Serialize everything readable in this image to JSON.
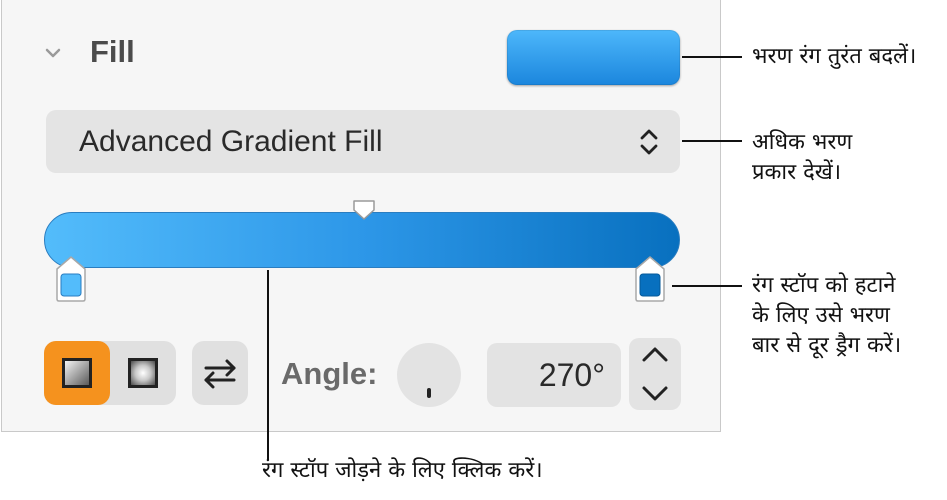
{
  "panel": {
    "section_title": "Fill",
    "fill_type": "Advanced Gradient Fill",
    "angle_label": "Angle:",
    "angle_value": "270°",
    "gradient_colors": [
      "#53bcfb",
      "#0870bf"
    ],
    "accent_color": "#f5921e",
    "icons": [
      "chevron-down-icon",
      "up-down-arrows-icon",
      "swap-arrows-icon",
      "chevron-up-icon",
      "chevron-down-icon"
    ]
  },
  "callouts": {
    "change_fill_color": "भरण रंग तुरंत बदलें।",
    "more_fill_types_line1": "अधिक भरण",
    "more_fill_types_line2": "प्रकार देखें।",
    "remove_stop_line1": "रंग स्टॉप को हटाने",
    "remove_stop_line2": "के लिए उसे भरण",
    "remove_stop_line3": "बार से दूर ड्रैग करें।",
    "add_stop": "रंग स्टॉप जोड़ने के लिए क्लिक करें।"
  }
}
